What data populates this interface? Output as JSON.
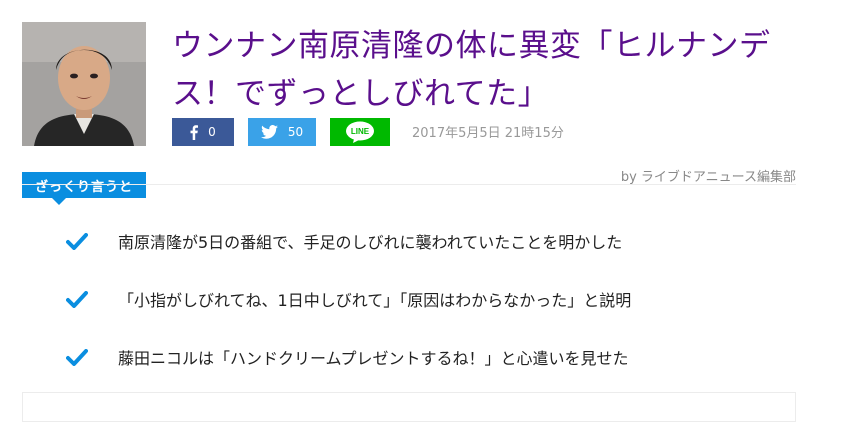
{
  "article": {
    "title": "ウンナン南原清隆の体に異変「ヒルナンデス！でずっとしびれてた」",
    "thumbnail_icon": "portrait-photo",
    "date": "2017年5月5日 21時15分",
    "byline": "by ライブドアニュース編集部"
  },
  "share": {
    "facebook_count": "0",
    "twitter_count": "50",
    "line_label": "LINE"
  },
  "summary": {
    "tab_label": "ざっくり言うと",
    "items": [
      "南原清隆が5日の番組で、手足のしびれに襲われていたことを明かした",
      "「小指がしびれてね、1日中しびれて」「原因はわからなかった」と説明",
      "藤田ニコルは「ハンドクリームプレゼントするね！」と心遣いを見せた"
    ]
  },
  "colors": {
    "title": "#5a0f8c",
    "facebook": "#3b5998",
    "twitter": "#3aa2e8",
    "line": "#00b900",
    "accent": "#0a8ee0"
  }
}
